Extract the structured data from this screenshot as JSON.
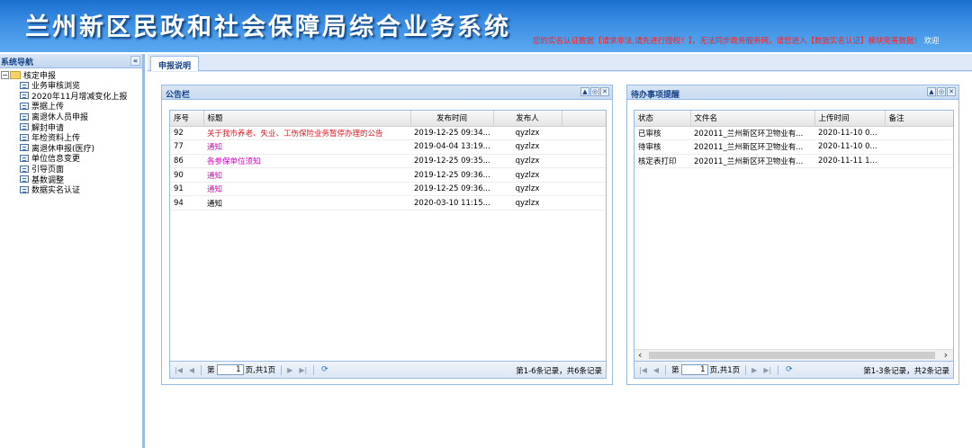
{
  "header": {
    "title": "兰州新区民政和社会保障局综合业务系统",
    "notice": "您的实名认证数据【请求非法,请先进行授权！】，无法同步政务服务网，请您进入【数据实名认证】模块完善数据！",
    "greeting": "欢迎"
  },
  "sidebar": {
    "title": "系统导航",
    "collapse": "«",
    "root": "核定申报",
    "items": [
      {
        "label": "业务审核浏览"
      },
      {
        "label": "2020年11月增减变化上报"
      },
      {
        "label": "票据上传"
      },
      {
        "label": "离退休人员申报"
      },
      {
        "label": "解封申请"
      },
      {
        "label": "年检资料上传"
      },
      {
        "label": "离退休申报(医疗)"
      },
      {
        "label": "单位信息变更"
      },
      {
        "label": "引导页面"
      },
      {
        "label": "基数调整"
      },
      {
        "label": "数据实名认证"
      }
    ]
  },
  "tabs": [
    {
      "label": "申报说明"
    }
  ],
  "bulletin": {
    "title": "公告栏",
    "columns": [
      "序号",
      "标题",
      "发布时间",
      "发布人"
    ],
    "rows": [
      {
        "no": "92",
        "title": "关于我市养老、失业、工伤保险业务暂停办理的公告",
        "time": "2019-12-25 09:34...",
        "publisher": "qyzlzx",
        "color": "#e8141c"
      },
      {
        "no": "77",
        "title": "通知",
        "time": "2019-04-04 13:19...",
        "publisher": "qyzlzx",
        "color": "#e000c8"
      },
      {
        "no": "86",
        "title": "各参保单位须知",
        "time": "2019-12-25 09:35...",
        "publisher": "qyzlzx",
        "color": "#e000c8"
      },
      {
        "no": "90",
        "title": "通知",
        "time": "2019-12-25 09:36...",
        "publisher": "qyzlzx",
        "color": "#e000c8"
      },
      {
        "no": "91",
        "title": "通知",
        "time": "2019-12-25 09:36...",
        "publisher": "qyzlzx",
        "color": "#e000c8"
      },
      {
        "no": "94",
        "title": "通知",
        "time": "2020-03-10 11:15...",
        "publisher": "qyzlzx",
        "color": "#000000"
      }
    ],
    "paging": {
      "page_label": "第",
      "page_value": "1",
      "page_total": "页,共1页",
      "info": "第1-6条记录，共6条记录"
    }
  },
  "todo": {
    "title": "待办事项提醒",
    "columns": [
      "状态",
      "文件名",
      "上传时间",
      "备注"
    ],
    "rows": [
      {
        "status": "已审核",
        "file": "202011_兰州新区环卫物业有...",
        "time": "2020-11-10 0...",
        "note": ""
      },
      {
        "status": "待审核",
        "file": "202011_兰州新区环卫物业有...",
        "time": "2020-11-10 0...",
        "note": ""
      },
      {
        "status": "核定表打印",
        "file": "202011_兰州新区环卫物业有...",
        "time": "2020-11-11 1...",
        "note": ""
      }
    ],
    "paging": {
      "page_label": "第",
      "page_value": "1",
      "page_total": "页,共1页",
      "info": "第1-3条记录，共2条记录"
    }
  }
}
